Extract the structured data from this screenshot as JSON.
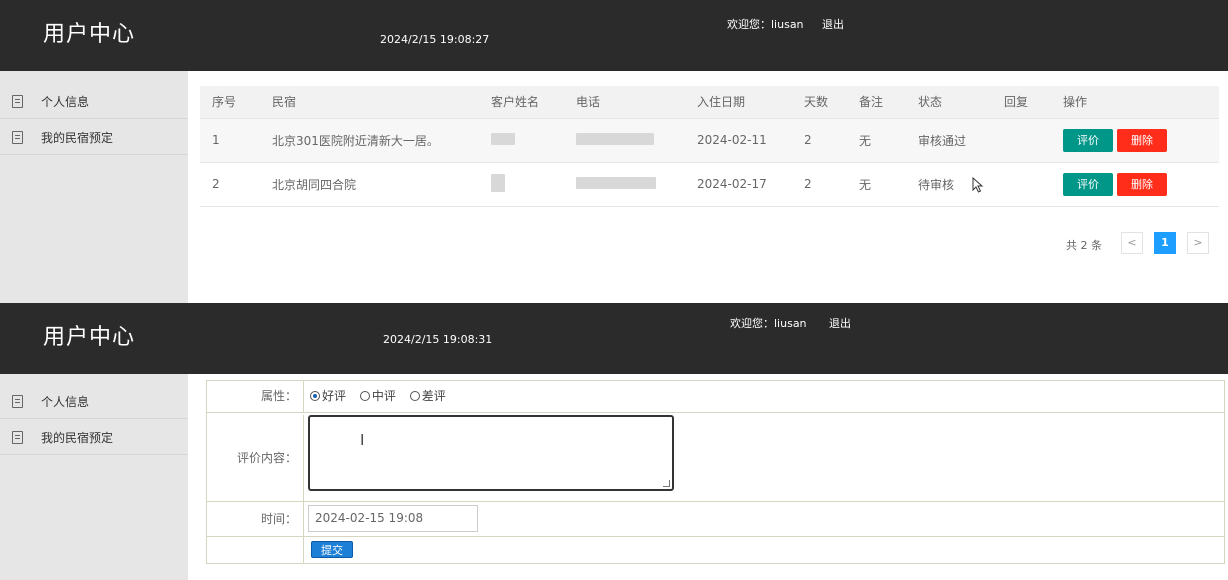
{
  "top": {
    "brand": "用户中心",
    "clock": "2024/2/15 19:08:27",
    "welcome": "欢迎您：liusan",
    "logout": "退出",
    "sidebar": [
      {
        "label": "个人信息",
        "icon": "document-icon"
      },
      {
        "label": "我的民宿预定",
        "icon": "document-icon"
      }
    ],
    "table": {
      "headers": [
        "序号",
        "民宿",
        "客户姓名",
        "电话",
        "入住日期",
        "天数",
        "备注",
        "状态",
        "回复",
        "操作"
      ],
      "rows": [
        {
          "index": "1",
          "name": "北京301医院附近清新大一居。",
          "date": "2024-02-11",
          "days": "2",
          "note": "无",
          "status": "审核通过",
          "reply": ""
        },
        {
          "index": "2",
          "name": "北京胡同四合院",
          "date": "2024-02-17",
          "days": "2",
          "note": "无",
          "status": "待审核",
          "reply": ""
        }
      ],
      "review_label": "评价",
      "delete_label": "删除"
    },
    "pager": {
      "total": "共 2 条",
      "prev": "<",
      "current": "1",
      "next": ">"
    }
  },
  "bottom": {
    "brand": "用户中心",
    "clock": "2024/2/15 19:08:31",
    "welcome": "欢迎您：liusan",
    "logout": "退出",
    "sidebar": [
      {
        "label": "个人信息",
        "icon": "document-icon"
      },
      {
        "label": "我的民宿预定",
        "icon": "document-icon"
      }
    ],
    "form": {
      "attr_label": "属性：",
      "options": [
        "好评",
        "中评",
        "差评"
      ],
      "selected": "好评",
      "content_label": "评价内容：",
      "content_value": "",
      "time_label": "时间：",
      "time_value": "2024-02-15 19:08",
      "submit_label": "提交"
    }
  },
  "colors": {
    "topbar": "#2b2b2b",
    "sidebar": "#e6e6e6",
    "review": "#009688",
    "delete": "#ff2d1a",
    "pager_active": "#1e9fff"
  }
}
